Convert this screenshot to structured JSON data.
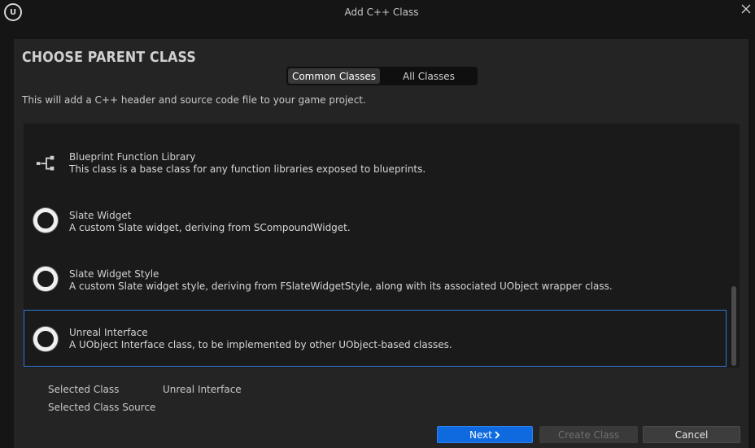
{
  "window": {
    "title": "Add C++ Class",
    "logo_icon": "unreal-engine-logo",
    "logo_text": "U",
    "close_icon": "close-icon"
  },
  "heading": "CHOOSE PARENT CLASS",
  "tabs": [
    {
      "label": "Common Classes",
      "active": true
    },
    {
      "label": "All Classes",
      "active": false
    }
  ],
  "description": "This will add a C++ header and source code file to your game project.",
  "classes": [
    {
      "name": "Blueprint Function Library",
      "description": "This class is a base class for any function libraries exposed to blueprints.",
      "icon": "function-library-icon",
      "selected": false
    },
    {
      "name": "Slate Widget",
      "description": "A custom Slate widget, deriving from SCompoundWidget.",
      "icon": "class-ring-icon",
      "selected": false
    },
    {
      "name": "Slate Widget Style",
      "description": "A custom Slate widget style, deriving from FSlateWidgetStyle, along with its associated UObject wrapper class.",
      "icon": "class-ring-icon",
      "selected": false
    },
    {
      "name": "Unreal Interface",
      "description": "A UObject Interface class, to be implemented by other UObject-based classes.",
      "icon": "class-ring-icon",
      "selected": true
    }
  ],
  "info": {
    "selected_class_label": "Selected Class",
    "selected_class_value": "Unreal Interface",
    "selected_class_source_label": "Selected Class Source",
    "selected_class_source_value": ""
  },
  "buttons": {
    "next": "Next",
    "next_icon": "chevron-right-icon",
    "create_class": "Create Class",
    "cancel": "Cancel"
  },
  "colors": {
    "accent": "#0f6ae0",
    "selection_border": "#2f78d8"
  }
}
